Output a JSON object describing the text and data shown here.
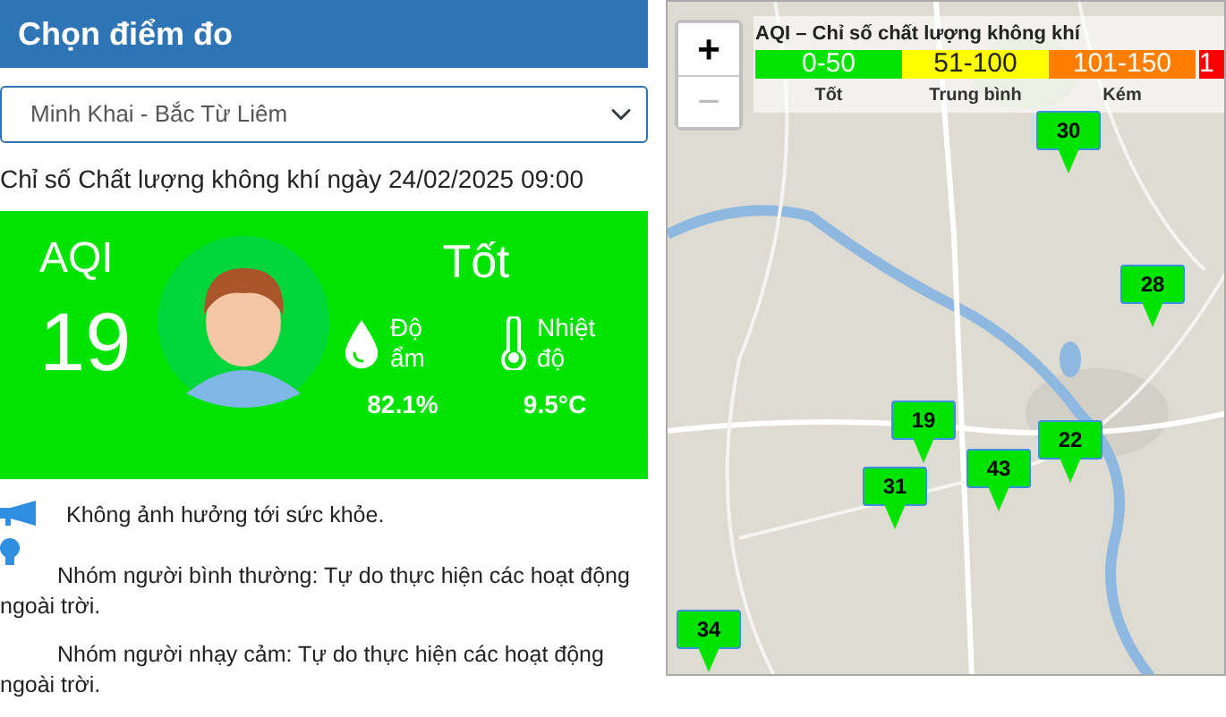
{
  "header": {
    "title": "Chọn điểm đo"
  },
  "station_select": {
    "value": "Minh Khai - Bắc Từ Liêm"
  },
  "reading_title": "Chỉ số Chất lượng không khí ngày 24/02/2025 09:00",
  "aqi_card": {
    "label": "AQI",
    "value": "19",
    "category": "Tốt",
    "metrics": [
      {
        "kind": "humidity",
        "label": "Độ ẩm",
        "value": "82.1%"
      },
      {
        "kind": "temperature",
        "label": "Nhiệt độ",
        "value": "9.5°C"
      }
    ]
  },
  "advice": [
    {
      "kind": "megaphone",
      "text": "Không ảnh hưởng tới sức khỏe."
    },
    {
      "kind": "bulb",
      "text": "Nhóm người bình thường: Tự do thực hiện các hoạt động ngoài trời."
    },
    {
      "kind": "plain",
      "text": "Nhóm người nhạy cảm: Tự do thực hiện các hoạt động ngoài trời."
    }
  ],
  "map": {
    "zoom_controls": [
      {
        "label": "+",
        "disabled": false
      },
      {
        "label": "−",
        "disabled": true
      }
    ],
    "legend": {
      "title": "AQI – Chỉ số chất lượng không khí",
      "bands": [
        {
          "range": "0-50",
          "label": "Tốt",
          "color": "#00e400"
        },
        {
          "range": "51-100",
          "label": "Trung bình",
          "color": "#ffff00"
        },
        {
          "range": "101-150",
          "label": "Kém",
          "color": "#ff7e00"
        },
        {
          "range": "1",
          "color": "#ff0000"
        }
      ]
    },
    "markers": [
      {
        "value": "30",
        "color": "#00e400"
      },
      {
        "value": "28",
        "color": "#00e400"
      },
      {
        "value": "19",
        "color": "#00e400"
      },
      {
        "value": "31",
        "color": "#00e400"
      },
      {
        "value": "43",
        "color": "#00e400"
      },
      {
        "value": "22",
        "color": "#00e400"
      },
      {
        "value": "34",
        "color": "#00e400"
      }
    ]
  }
}
